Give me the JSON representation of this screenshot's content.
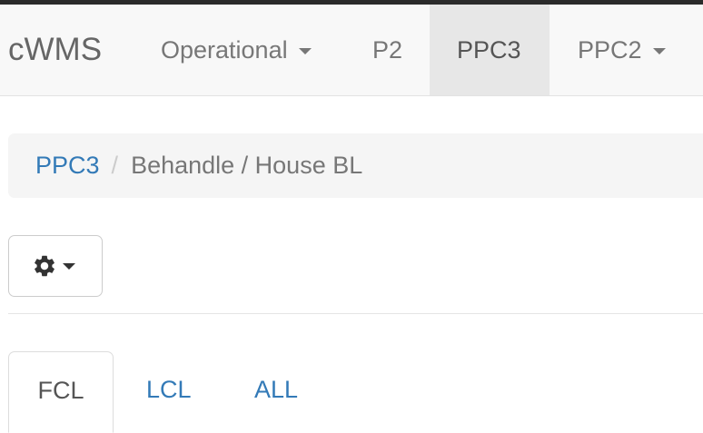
{
  "navbar": {
    "brand": "cWMS",
    "items": [
      {
        "label": "Operational",
        "dropdown": true,
        "active": false
      },
      {
        "label": "P2",
        "dropdown": false,
        "active": false
      },
      {
        "label": "PPC3",
        "dropdown": false,
        "active": true
      },
      {
        "label": "PPC2",
        "dropdown": true,
        "active": false
      }
    ]
  },
  "breadcrumb": {
    "link": "PPC3",
    "separator": "/",
    "current": "Behandle / House BL"
  },
  "toolbar": {
    "settings_icon": "gear-icon",
    "dropdown_icon": "caret-down-icon"
  },
  "tabs": [
    {
      "label": "FCL",
      "active": true
    },
    {
      "label": "LCL",
      "active": false
    },
    {
      "label": "ALL",
      "active": false
    }
  ],
  "colors": {
    "link": "#337ab7",
    "navbar_bg": "#f8f8f8",
    "active_nav_bg": "#e7e7e7",
    "breadcrumb_bg": "#f5f5f5"
  }
}
